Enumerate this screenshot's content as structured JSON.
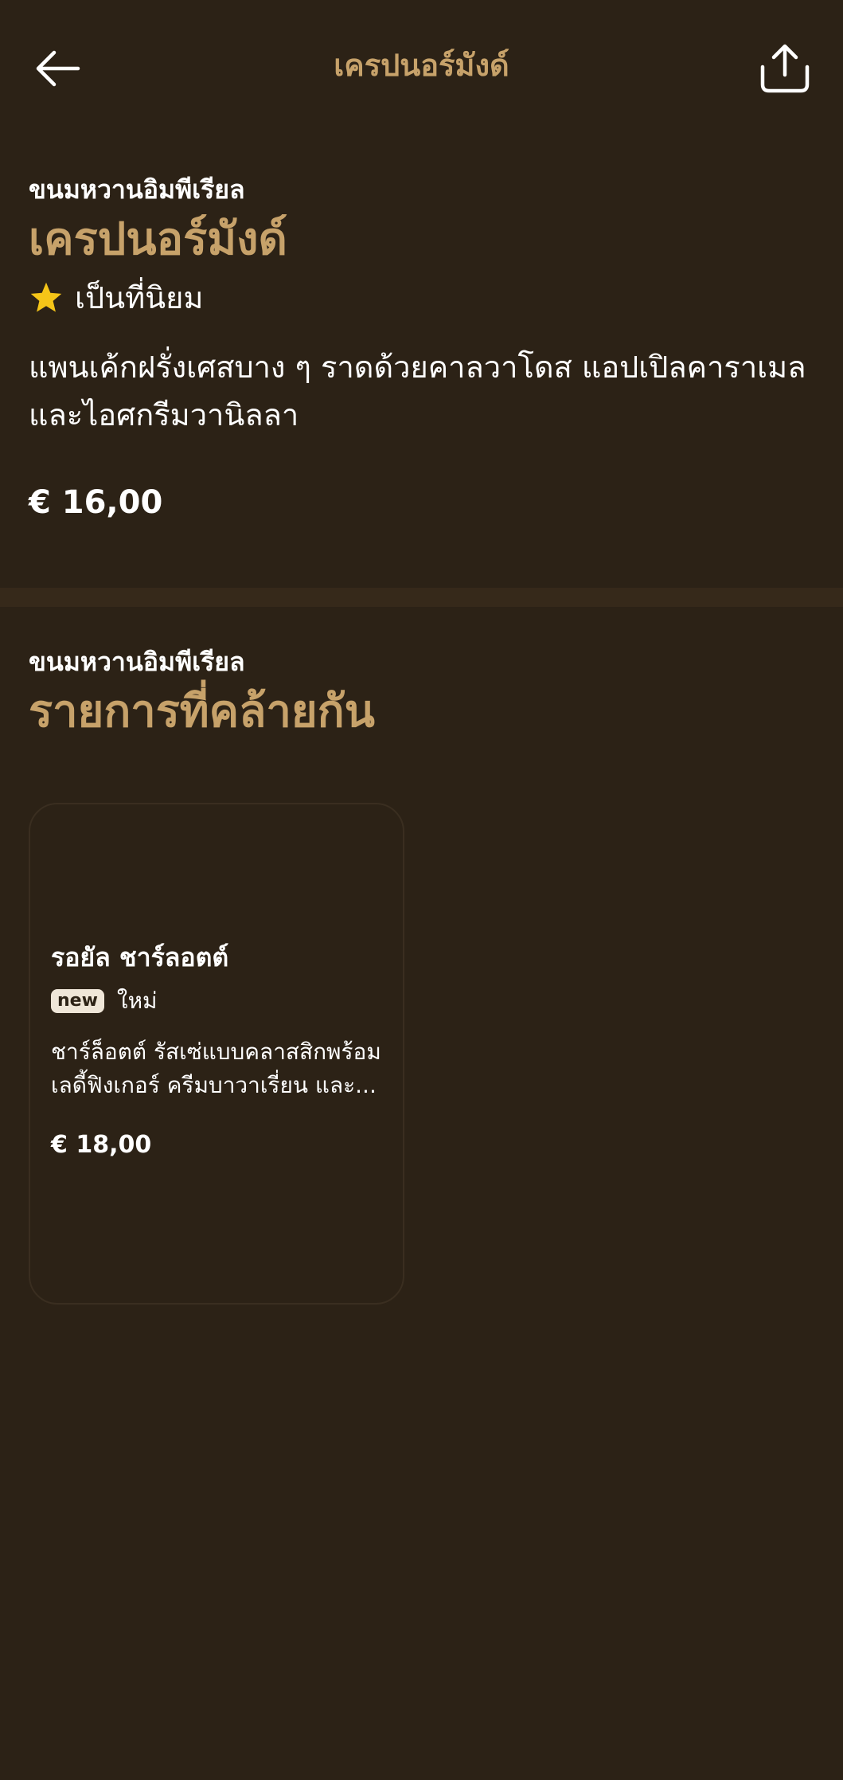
{
  "header": {
    "title": "เครปนอร์มังด์",
    "back_icon": "arrow-left-icon",
    "share_icon": "share-icon"
  },
  "item": {
    "category": "ขนมหวานอิมพีเรียล",
    "title": "เครปนอร์มังด์",
    "popular_label": "เป็นที่นิยม",
    "description": "แพนเค้กฝรั่งเศสบาง ๆ ราดด้วยคาลวาโดส แอปเปิลคาราเมล และไอศกรีมวานิลลา",
    "price": "€ 16,00"
  },
  "similar": {
    "category": "ขนมหวานอิมพีเรียล",
    "title": "รายการที่คล้ายกัน",
    "items": [
      {
        "name": "รอยัล ชาร์ลอตต์",
        "badge": "new",
        "badge_text": "ใหม่",
        "description": "ชาร์ล็อตต์ รัสเซ่แบบคลาสสิกพร้อมเลดี้ฟิงเกอร์ ครีมบาวาเรี่ยน และ...",
        "price": "€ 18,00"
      }
    ]
  },
  "colors": {
    "background": "#2c2216",
    "accent": "#c7a26a",
    "star": "#f5c518",
    "text": "#ffffff"
  }
}
